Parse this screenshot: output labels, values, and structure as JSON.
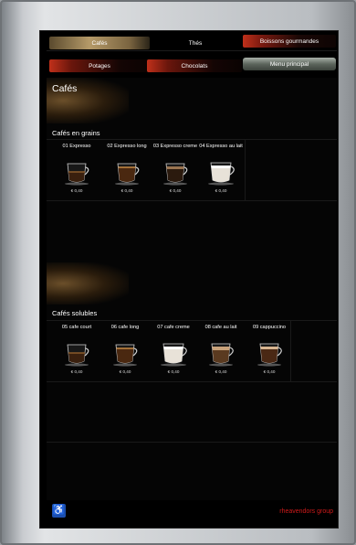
{
  "nav": {
    "cafes": "Cafés",
    "thes": "Thés",
    "boissons": "Boissons gourmandes",
    "potages": "Potages",
    "chocolats": "Chocolats",
    "menu": "Menu principal"
  },
  "page_title": "Cafés",
  "grains": {
    "title": "Cafés en grains",
    "items": [
      {
        "label": "01 Expresso",
        "price": "€ 0,40",
        "cup": "espresso"
      },
      {
        "label": "02 Expresso long",
        "price": "€ 0,40",
        "cup": "long"
      },
      {
        "label": "03 Expresso creme",
        "price": "€ 0,40",
        "cup": "creme"
      },
      {
        "label": "04 Expresso au lait",
        "price": "€ 0,40",
        "cup": "lait"
      }
    ]
  },
  "solubles": {
    "title": "Cafés solubles",
    "items": [
      {
        "label": "05 cafe court",
        "price": "€ 0,40",
        "cup": "espresso"
      },
      {
        "label": "06 cafe long",
        "price": "€ 0,40",
        "cup": "long"
      },
      {
        "label": "07 cafe creme",
        "price": "€ 0,40",
        "cup": "lait"
      },
      {
        "label": "08 cafe au lait",
        "price": "€ 0,40",
        "cup": "aulait"
      },
      {
        "label": "09 cappuccino",
        "price": "€ 0,40",
        "cup": "cappuccino"
      }
    ]
  },
  "footer": {
    "accessibility_icon": "wheelchair-icon",
    "brand": "rheavendors group"
  },
  "colors": {
    "accent_red": "#c0301a",
    "gold": "#b59a68",
    "brand_red": "#d01a1a"
  }
}
